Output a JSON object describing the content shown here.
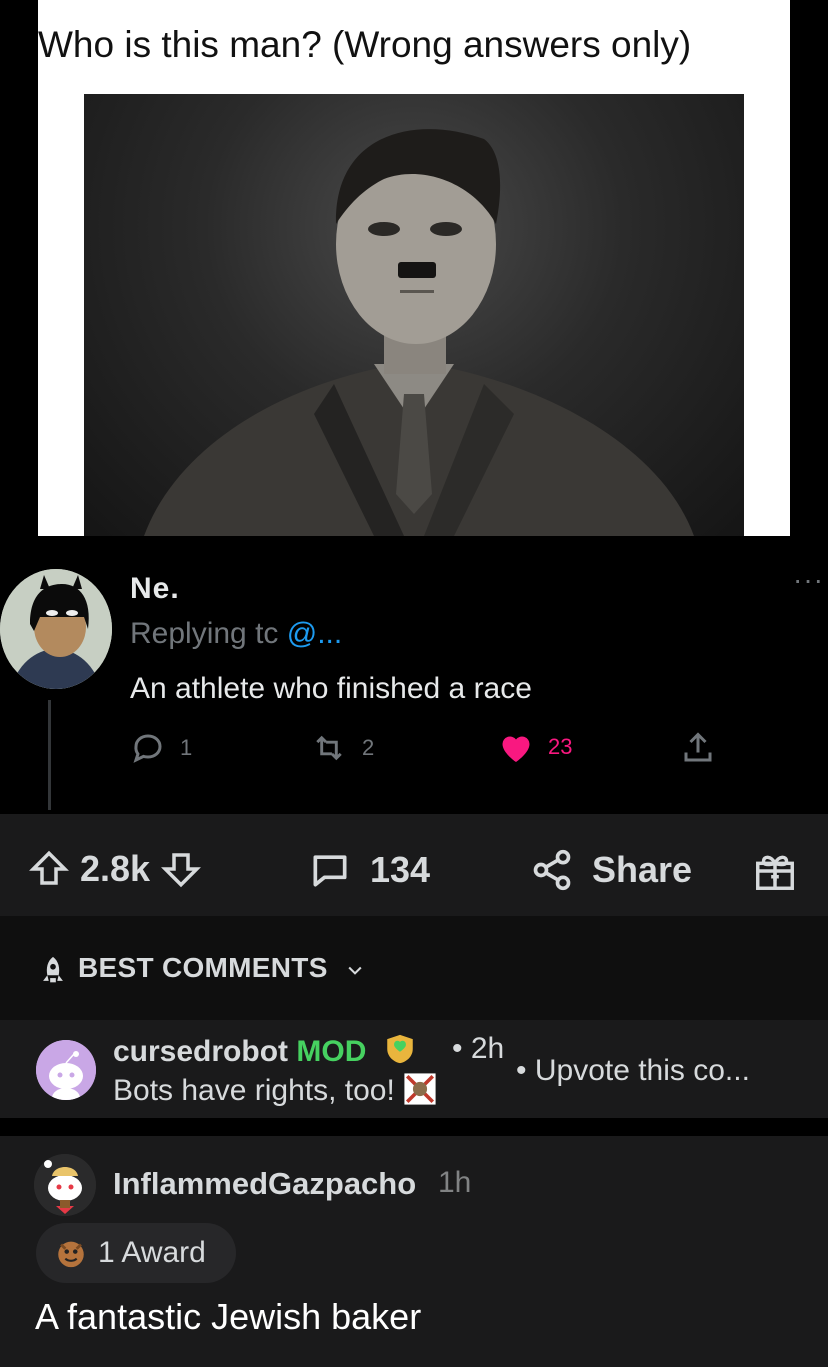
{
  "meme": {
    "title": "Who is this man? (Wrong answers only)"
  },
  "tweet": {
    "author_name": "Ne.",
    "more_label": "···",
    "replying_prefix": "Replying tc",
    "replying_handle": "@...",
    "text": "An athlete who finished a race",
    "reply_count": "1",
    "retweet_count": "2",
    "like_count": "23"
  },
  "post_actions": {
    "score": "2.8k",
    "comment_count": "134",
    "share_label": "Share"
  },
  "sort": {
    "label": "BEST COMMENTS"
  },
  "mod_comment": {
    "username": "cursedrobot",
    "mod_tag": "MOD",
    "time": "• 2h",
    "text": "Bots have rights, too!",
    "upvote_text": "• Upvote this co..."
  },
  "user_comment": {
    "username": "InflammedGazpacho",
    "time": "1h",
    "award_label": "1 Award",
    "text": "A fantastic Jewish baker"
  },
  "colors": {
    "like": "#f91880",
    "mod_green": "#46d160",
    "twitter_blue": "#1d9bf0",
    "reddit_card": "#1a1a1b"
  }
}
